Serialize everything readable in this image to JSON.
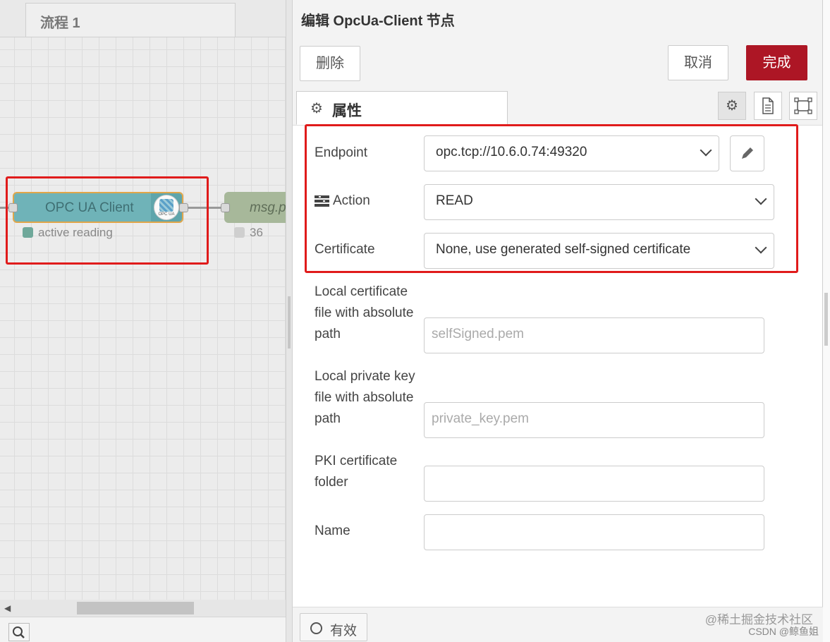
{
  "canvas": {
    "flow_tab": "流程 1",
    "opc_node": {
      "label": "OPC UA Client",
      "logo_text": "OPC UA",
      "status": "active reading"
    },
    "msg_node": {
      "label": "msg.p",
      "status": "36"
    }
  },
  "editor": {
    "title": "编辑 OpcUa-Client 节点",
    "delete_label": "删除",
    "cancel_label": "取消",
    "done_label": "完成",
    "props_tab_label": "属性",
    "form": {
      "endpoint_label": "Endpoint",
      "endpoint_value": "opc.tcp://10.6.0.74:49320",
      "action_label": "Action",
      "action_value": "READ",
      "certificate_label": "Certificate",
      "certificate_value": "None, use generated self-signed certificate",
      "local_cert_label": "Local certificate file with absolute path",
      "local_cert_placeholder": "selfSigned.pem",
      "local_key_label": "Local private key file with absolute path",
      "local_key_placeholder": "private_key.pem",
      "pki_label": "PKI certificate folder",
      "name_label": "Name"
    },
    "enabled_label": "有效"
  },
  "watermark": {
    "line1": "@稀土掘金技术社区",
    "line2": "CSDN @鲸鱼姐"
  },
  "colors": {
    "done_button": "#ad1625",
    "highlight": "#e01b1b",
    "opc_node": "#6fb3b8",
    "msg_node": "#a7b89a"
  }
}
